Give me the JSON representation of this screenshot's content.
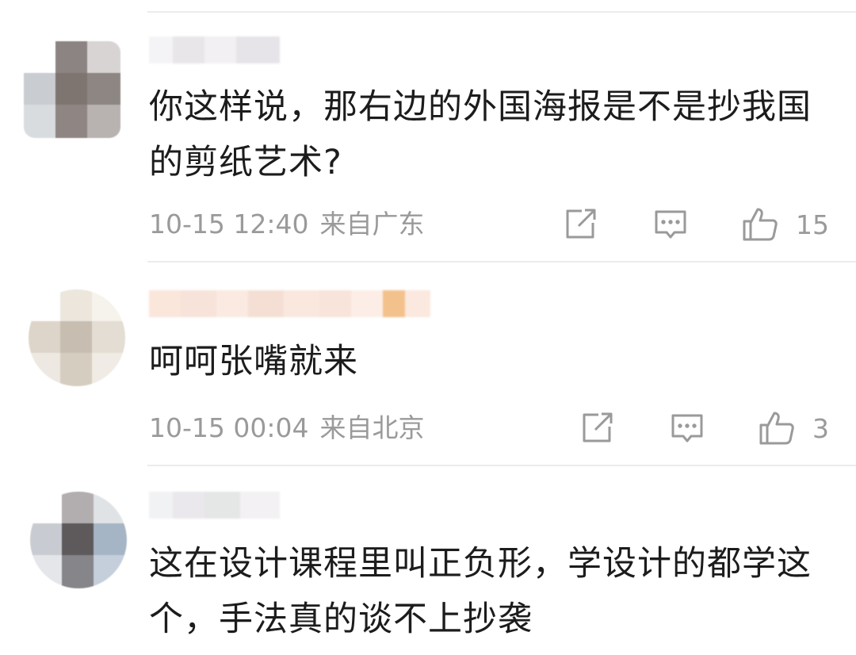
{
  "comments": [
    {
      "text": "你这样说，那右边的外国海报是不是抄我国的剪纸艺术?",
      "time": "10-15 12:40",
      "location": "来自广东",
      "likes": "15"
    },
    {
      "text": "呵呵张嘴就来",
      "time": "10-15 00:04",
      "location": "来自北京",
      "likes": "3"
    },
    {
      "text": "这在设计课程里叫正负形，学设计的都学这个，手法真的谈不上抄袭"
    }
  ],
  "icons": {
    "share": "share-icon",
    "reply": "comment-icon",
    "like": "thumbs-up-icon"
  },
  "colors": {
    "text": "#1c1c1c",
    "meta": "#9a9a9a",
    "divider": "#ececec"
  }
}
